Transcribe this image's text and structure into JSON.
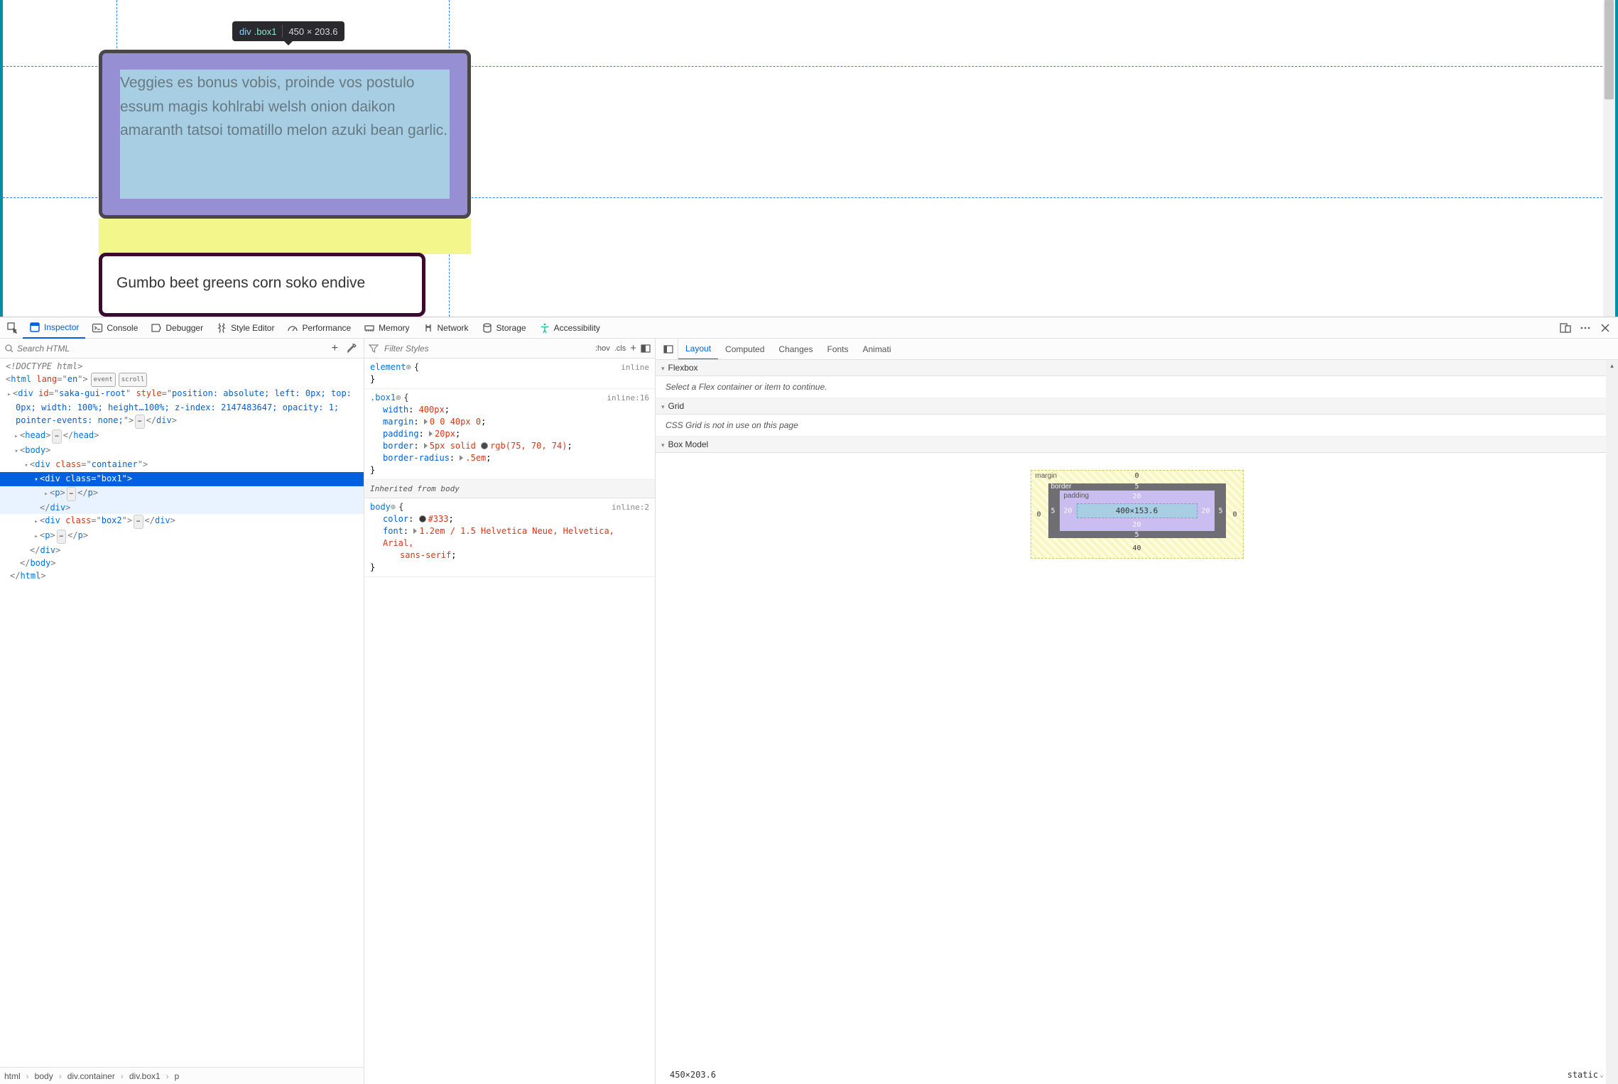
{
  "viewport": {
    "tooltip": {
      "tag": "div",
      "class": ".box1",
      "dims": "450 × 203.6"
    },
    "box1_text": "Veggies es bonus vobis, proinde vos postulo essum magis kohlrabi welsh onion daikon amaranth tatsoi tomatillo melon azuki bean garlic.",
    "box2_text": "Gumbo beet greens corn soko endive"
  },
  "toolbar": {
    "inspector": "Inspector",
    "console": "Console",
    "debugger": "Debugger",
    "style_editor": "Style Editor",
    "performance": "Performance",
    "memory": "Memory",
    "network": "Network",
    "storage": "Storage",
    "accessibility": "Accessibility"
  },
  "dom": {
    "search_placeholder": "Search HTML",
    "doctype": "<!DOCTYPE html>",
    "html_open": "<html lang=\"en\">",
    "event_badge": "event",
    "scroll_badge": "scroll",
    "saka1": "<div id=\"saka-gui-root\" style=\"position: absolute; left: 0px; top:",
    "saka2": "0px; width: 100%; height…100%; z-index: 2147483647; opacity: 1;",
    "saka3": "pointer-events: none;\">",
    "saka_close": "</div>",
    "head_open": "<head>",
    "head_close": "</head>",
    "body_open": "<body>",
    "container_open": "<div class=\"container\">",
    "box1_open": "<div class=\"box1\">",
    "p_open": "<p>",
    "p_close": "</p>",
    "div_close": "</div>",
    "box2_open": "<div class=\"box2\">",
    "body_close": "</body>",
    "html_close": "</html>"
  },
  "crumbs": [
    "html",
    "body",
    "div.container",
    "div.box1",
    "p"
  ],
  "styles": {
    "filter_placeholder": "Filter Styles",
    "hov": ":hov",
    "cls": ".cls",
    "element_sel": "element",
    "element_src": "inline",
    "box1_sel": ".box1",
    "box1_src": "inline:16",
    "decl_width": {
      "p": "width",
      "v": "400px"
    },
    "decl_margin": {
      "p": "margin",
      "v": "0 0 40px 0"
    },
    "decl_padding": {
      "p": "padding",
      "v": "20px"
    },
    "decl_border_p": "border",
    "decl_border_v1": "5px solid",
    "decl_border_v2": "rgb(75, 70, 74)",
    "decl_border_swatch": "#4b464a",
    "decl_radius": {
      "p": "border-radius",
      "v": ".5em"
    },
    "inherited_label": "Inherited from body",
    "body_sel": "body",
    "body_src": "inline:2",
    "decl_color_p": "color",
    "decl_color_v": "#333",
    "decl_color_swatch": "#333333",
    "decl_font_p": "font",
    "decl_font_v1": "1.2em / 1.5 Helvetica Neue, Helvetica, Arial,",
    "decl_font_v2": "sans-serif"
  },
  "layout": {
    "tab_layout": "Layout",
    "tab_computed": "Computed",
    "tab_changes": "Changes",
    "tab_fonts": "Fonts",
    "tab_animations": "Animati",
    "flexbox_hdr": "Flexbox",
    "flexbox_msg": "Select a Flex container or item to continue.",
    "grid_hdr": "Grid",
    "grid_msg": "CSS Grid is not in use on this page",
    "boxmodel_hdr": "Box Model",
    "bm_labels": {
      "margin": "margin",
      "border": "border",
      "padding": "padding"
    },
    "bm_margin": {
      "top": "0",
      "right": "0",
      "bottom": "40",
      "left": "0"
    },
    "bm_border": {
      "top": "5",
      "right": "5",
      "bottom": "5",
      "left": "5"
    },
    "bm_padding": {
      "top": "20",
      "right": "20",
      "bottom": "20",
      "left": "20"
    },
    "bm_content": "400×153.6",
    "result_dims": "450×203.6",
    "position": "static"
  }
}
